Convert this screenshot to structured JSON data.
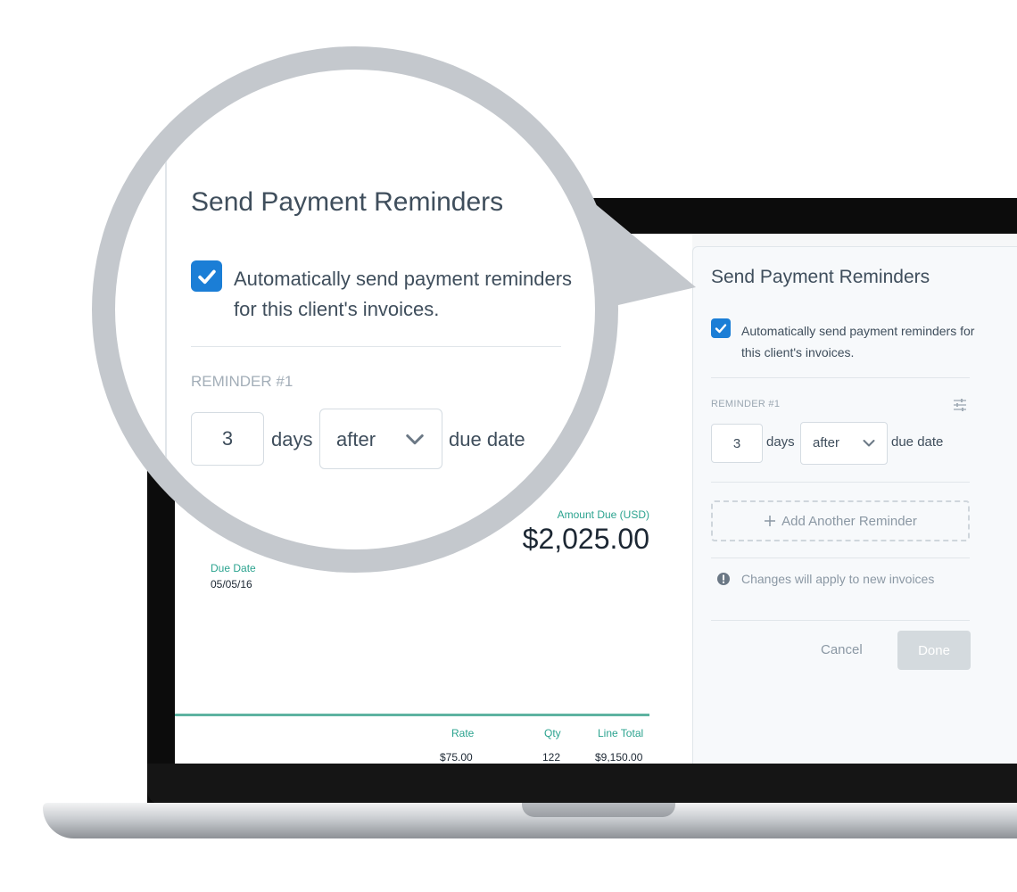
{
  "panel": {
    "title": "Send Payment Reminders",
    "auto_send_checked": true,
    "auto_send_label": "Automatically send payment reminders for this client's invoices.",
    "reminder_label": "REMINDER #1",
    "days_value": "3",
    "days_unit": "days",
    "timing_selected": "after",
    "due_date_text": "due date",
    "add_reminder_label": "Add Another Reminder",
    "info_text": "Changes will apply to new invoices",
    "cancel_label": "Cancel",
    "done_label": "Done"
  },
  "invoice": {
    "amount_due_label": "Amount Due (USD)",
    "amount_due_value": "$2,025.00",
    "due_date_label": "Due Date",
    "due_date_value": "05/05/16",
    "columns": {
      "rate": "Rate",
      "qty": "Qty",
      "line_total": "Line Total"
    },
    "row": {
      "rate": "$75.00",
      "qty": "122",
      "line_total": "$9,150.00"
    }
  },
  "colors": {
    "accent_blue": "#1b7ed6",
    "accent_teal": "#2ba38f",
    "done_disabled": "#d4dade"
  },
  "icons": [
    "checkmark-icon",
    "chevron-down-icon",
    "settings-sliders-icon",
    "plus-icon",
    "info-icon"
  ]
}
